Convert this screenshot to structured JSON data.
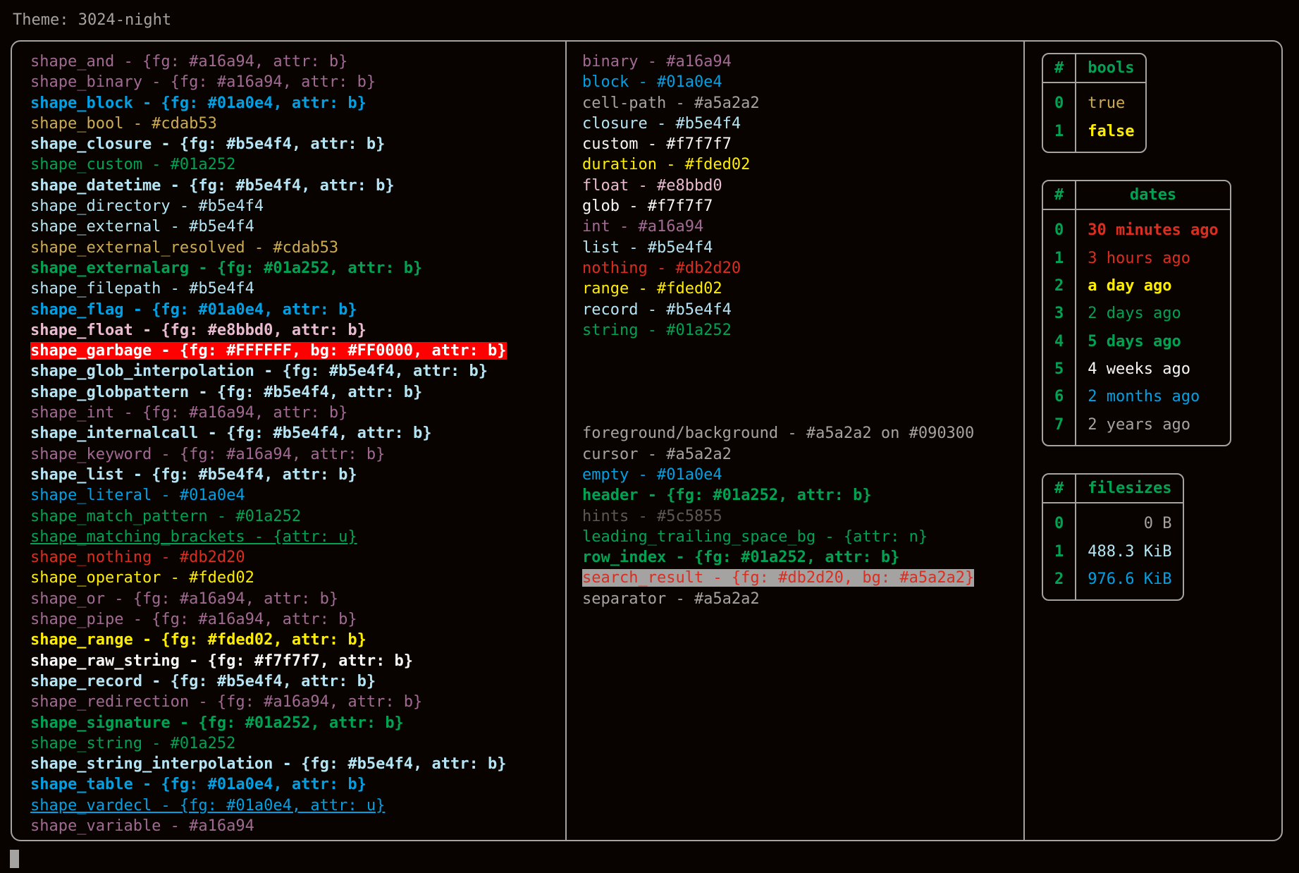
{
  "theme_line": "Theme: 3024-night",
  "palette": {
    "background": "#090300",
    "foreground": "#a5a2a2",
    "purple": "#a16a94",
    "blue": "#01a0e4",
    "yellow_dim": "#cdab53",
    "cyan": "#b5e4f4",
    "green": "#01a252",
    "pink": "#e8bbd0",
    "red": "#db2d20",
    "yellow": "#fded02",
    "white": "#f7f7f7",
    "grey": "#a5a2a2",
    "hint_grey": "#5c5855",
    "garbage_fg": "#FFFFFF",
    "garbage_bg": "#FF0000"
  },
  "left_column": [
    {
      "text": "shape_and - {fg: #a16a94, attr: b}",
      "color": "#a16a94",
      "bold": false,
      "underline": false
    },
    {
      "text": "shape_binary - {fg: #a16a94, attr: b}",
      "color": "#a16a94",
      "bold": false,
      "underline": false
    },
    {
      "text": "shape_block - {fg: #01a0e4, attr: b}",
      "color": "#01a0e4",
      "bold": true,
      "underline": false
    },
    {
      "text": "shape_bool - #cdab53",
      "color": "#cdab53",
      "bold": false,
      "underline": false
    },
    {
      "text": "shape_closure - {fg: #b5e4f4, attr: b}",
      "color": "#b5e4f4",
      "bold": true,
      "underline": false
    },
    {
      "text": "shape_custom - #01a252",
      "color": "#01a252",
      "bold": false,
      "underline": false
    },
    {
      "text": "shape_datetime - {fg: #b5e4f4, attr: b}",
      "color": "#b5e4f4",
      "bold": true,
      "underline": false
    },
    {
      "text": "shape_directory - #b5e4f4",
      "color": "#b5e4f4",
      "bold": false,
      "underline": false
    },
    {
      "text": "shape_external - #b5e4f4",
      "color": "#b5e4f4",
      "bold": false,
      "underline": false
    },
    {
      "text": "shape_external_resolved - #cdab53",
      "color": "#cdab53",
      "bold": false,
      "underline": false
    },
    {
      "text": "shape_externalarg - {fg: #01a252, attr: b}",
      "color": "#01a252",
      "bold": true,
      "underline": false
    },
    {
      "text": "shape_filepath - #b5e4f4",
      "color": "#b5e4f4",
      "bold": false,
      "underline": false
    },
    {
      "text": "shape_flag - {fg: #01a0e4, attr: b}",
      "color": "#01a0e4",
      "bold": true,
      "underline": false
    },
    {
      "text": "shape_float - {fg: #e8bbd0, attr: b}",
      "color": "#e8bbd0",
      "bold": true,
      "underline": false
    },
    {
      "text": "shape_garbage - {fg: #FFFFFF, bg: #FF0000, attr: b}",
      "color": "#FFFFFF",
      "bg": "#FF0000",
      "bold": true,
      "underline": false
    },
    {
      "text": "shape_glob_interpolation - {fg: #b5e4f4, attr: b}",
      "color": "#b5e4f4",
      "bold": true,
      "underline": false
    },
    {
      "text": "shape_globpattern - {fg: #b5e4f4, attr: b}",
      "color": "#b5e4f4",
      "bold": true,
      "underline": false
    },
    {
      "text": "shape_int - {fg: #a16a94, attr: b}",
      "color": "#a16a94",
      "bold": false,
      "underline": false
    },
    {
      "text": "shape_internalcall - {fg: #b5e4f4, attr: b}",
      "color": "#b5e4f4",
      "bold": true,
      "underline": false
    },
    {
      "text": "shape_keyword - {fg: #a16a94, attr: b}",
      "color": "#a16a94",
      "bold": false,
      "underline": false
    },
    {
      "text": "shape_list - {fg: #b5e4f4, attr: b}",
      "color": "#b5e4f4",
      "bold": true,
      "underline": false
    },
    {
      "text": "shape_literal - #01a0e4",
      "color": "#01a0e4",
      "bold": false,
      "underline": false
    },
    {
      "text": "shape_match_pattern - #01a252",
      "color": "#01a252",
      "bold": false,
      "underline": false
    },
    {
      "text": "shape_matching_brackets - {attr: u}",
      "color": "#01a252",
      "bold": false,
      "underline": true
    },
    {
      "text": "shape_nothing - #db2d20",
      "color": "#db2d20",
      "bold": false,
      "underline": false
    },
    {
      "text": "shape_operator - #fded02",
      "color": "#fded02",
      "bold": false,
      "underline": false
    },
    {
      "text": "shape_or - {fg: #a16a94, attr: b}",
      "color": "#a16a94",
      "bold": false,
      "underline": false
    },
    {
      "text": "shape_pipe - {fg: #a16a94, attr: b}",
      "color": "#a16a94",
      "bold": false,
      "underline": false
    },
    {
      "text": "shape_range - {fg: #fded02, attr: b}",
      "color": "#fded02",
      "bold": true,
      "underline": false
    },
    {
      "text": "shape_raw_string - {fg: #f7f7f7, attr: b}",
      "color": "#f7f7f7",
      "bold": true,
      "underline": false
    },
    {
      "text": "shape_record - {fg: #b5e4f4, attr: b}",
      "color": "#b5e4f4",
      "bold": true,
      "underline": false
    },
    {
      "text": "shape_redirection - {fg: #a16a94, attr: b}",
      "color": "#a16a94",
      "bold": false,
      "underline": false
    },
    {
      "text": "shape_signature - {fg: #01a252, attr: b}",
      "color": "#01a252",
      "bold": true,
      "underline": false
    },
    {
      "text": "shape_string - #01a252",
      "color": "#01a252",
      "bold": false,
      "underline": false
    },
    {
      "text": "shape_string_interpolation - {fg: #b5e4f4, attr: b}",
      "color": "#b5e4f4",
      "bold": true,
      "underline": false
    },
    {
      "text": "shape_table - {fg: #01a0e4, attr: b}",
      "color": "#01a0e4",
      "bold": true,
      "underline": false
    },
    {
      "text": "shape_vardecl - {fg: #01a0e4, attr: u}",
      "color": "#01a0e4",
      "bold": false,
      "underline": true
    },
    {
      "text": "shape_variable - #a16a94",
      "color": "#a16a94",
      "bold": false,
      "underline": false
    }
  ],
  "middle_column_types": [
    {
      "text": "binary - #a16a94",
      "color": "#a16a94",
      "bold": false,
      "underline": false
    },
    {
      "text": "block - #01a0e4",
      "color": "#01a0e4",
      "bold": false,
      "underline": false
    },
    {
      "text": "cell-path - #a5a2a2",
      "color": "#a5a2a2",
      "bold": false,
      "underline": false
    },
    {
      "text": "closure - #b5e4f4",
      "color": "#b5e4f4",
      "bold": false,
      "underline": false
    },
    {
      "text": "custom - #f7f7f7",
      "color": "#f7f7f7",
      "bold": false,
      "underline": false
    },
    {
      "text": "duration - #fded02",
      "color": "#fded02",
      "bold": false,
      "underline": false
    },
    {
      "text": "float - #e8bbd0",
      "color": "#e8bbd0",
      "bold": false,
      "underline": false
    },
    {
      "text": "glob - #f7f7f7",
      "color": "#f7f7f7",
      "bold": false,
      "underline": false
    },
    {
      "text": "int - #a16a94",
      "color": "#a16a94",
      "bold": false,
      "underline": false
    },
    {
      "text": "list - #b5e4f4",
      "color": "#b5e4f4",
      "bold": false,
      "underline": false
    },
    {
      "text": "nothing - #db2d20",
      "color": "#db2d20",
      "bold": false,
      "underline": false
    },
    {
      "text": "range - #fded02",
      "color": "#fded02",
      "bold": false,
      "underline": false
    },
    {
      "text": "record - #b5e4f4",
      "color": "#b5e4f4",
      "bold": false,
      "underline": false
    },
    {
      "text": "string - #01a252",
      "color": "#01a252",
      "bold": false,
      "underline": false
    }
  ],
  "middle_column_ui": [
    {
      "text": "foreground/background - #a5a2a2 on #090300",
      "color": "#a5a2a2",
      "bold": false,
      "underline": false
    },
    {
      "text": "cursor - #a5a2a2",
      "color": "#a5a2a2",
      "bold": false,
      "underline": false
    },
    {
      "text": "empty - #01a0e4",
      "color": "#01a0e4",
      "bold": false,
      "underline": false
    },
    {
      "text": "header - {fg: #01a252, attr: b}",
      "color": "#01a252",
      "bold": true,
      "underline": false
    },
    {
      "text": "hints - #5c5855",
      "color": "#5c5855",
      "bold": false,
      "underline": false
    },
    {
      "text": "leading_trailing_space_bg - {attr: n}",
      "color": "#01a252",
      "bold": false,
      "underline": false
    },
    {
      "text": "row_index - {fg: #01a252, attr: b}",
      "color": "#01a252",
      "bold": true,
      "underline": false
    },
    {
      "text": "search_result - {fg: #db2d20, bg: #a5a2a2}",
      "color": "#db2d20",
      "bg": "#a5a2a2",
      "bold": false,
      "underline": false
    },
    {
      "text": "separator - #a5a2a2",
      "color": "#a5a2a2",
      "bold": false,
      "underline": false
    }
  ],
  "tables": [
    {
      "name": "bools",
      "index_header": "#",
      "value_header": "bools",
      "align": "left",
      "rows": [
        {
          "index": "0",
          "value": "true",
          "color": "#cdab53",
          "bold": false
        },
        {
          "index": "1",
          "value": "false",
          "color": "#fded02",
          "bold": true
        }
      ]
    },
    {
      "name": "dates",
      "index_header": "#",
      "value_header": "dates",
      "align": "left",
      "rows": [
        {
          "index": "0",
          "value": "30 minutes ago",
          "color": "#db2d20",
          "bold": true
        },
        {
          "index": "1",
          "value": "3 hours ago",
          "color": "#db2d20",
          "bold": false
        },
        {
          "index": "2",
          "value": "a day ago",
          "color": "#fded02",
          "bold": true
        },
        {
          "index": "3",
          "value": "2 days ago",
          "color": "#01a252",
          "bold": false
        },
        {
          "index": "4",
          "value": "5 days ago",
          "color": "#01a252",
          "bold": true
        },
        {
          "index": "5",
          "value": "4 weeks ago",
          "color": "#f7f7f7",
          "bold": false
        },
        {
          "index": "6",
          "value": "2 months ago",
          "color": "#01a0e4",
          "bold": false
        },
        {
          "index": "7",
          "value": "2 years ago",
          "color": "#a5a2a2",
          "bold": false
        }
      ]
    },
    {
      "name": "filesizes",
      "index_header": "#",
      "value_header": "filesizes",
      "align": "right",
      "rows": [
        {
          "index": "0",
          "value": "0 B",
          "color": "#a5a2a2",
          "bold": false
        },
        {
          "index": "1",
          "value": "488.3 KiB",
          "color": "#b5e4f4",
          "bold": false
        },
        {
          "index": "2",
          "value": "976.6 KiB",
          "color": "#01a0e4",
          "bold": false
        }
      ]
    }
  ]
}
